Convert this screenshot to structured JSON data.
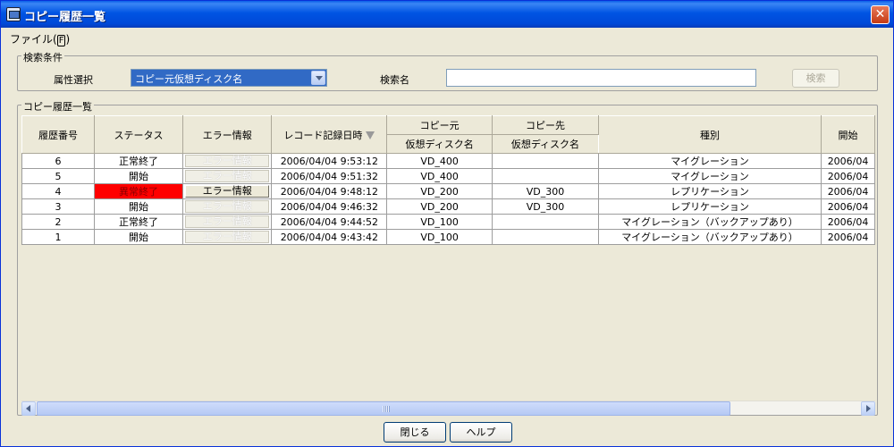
{
  "window": {
    "title": "コピー履歴一覧",
    "close_glyph": "✕"
  },
  "menu": {
    "file_label": "ファイル",
    "file_mnemonic": "F"
  },
  "search": {
    "group_label": "検索条件",
    "attr_label": "属性選択",
    "attr_value": "コピー元仮想ディスク名",
    "name_label": "検索名",
    "name_value": "",
    "button_label": "検索"
  },
  "list": {
    "group_label": "コピー履歴一覧",
    "columns": {
      "history_no": "履歴番号",
      "status": "ステータス",
      "error_info": "エラー情報",
      "record_time": "レコード記録日時",
      "copy_source": "コピー元",
      "copy_dest": "コピー先",
      "source_vdisk": "仮想ディスク名",
      "dest_vdisk": "仮想ディスク名",
      "type": "種別",
      "start": "開始"
    },
    "rows": [
      {
        "no": "6",
        "status": "正常終了",
        "error_btn": "エラー情報",
        "error_enabled": false,
        "time": "2006/04/04 9:53:12",
        "source": "VD_400",
        "dest": "",
        "type": "マイグレーション",
        "start": "2006/04"
      },
      {
        "no": "5",
        "status": "開始",
        "error_btn": "エラー情報",
        "error_enabled": false,
        "time": "2006/04/04 9:51:32",
        "source": "VD_400",
        "dest": "",
        "type": "マイグレーション",
        "start": "2006/04"
      },
      {
        "no": "4",
        "status": "異常終了",
        "error_btn": "エラー情報",
        "error_enabled": true,
        "time": "2006/04/04 9:48:12",
        "source": "VD_200",
        "dest": "VD_300",
        "type": "レプリケーション",
        "start": "2006/04"
      },
      {
        "no": "3",
        "status": "開始",
        "error_btn": "エラー情報",
        "error_enabled": false,
        "time": "2006/04/04 9:46:32",
        "source": "VD_200",
        "dest": "VD_300",
        "type": "レプリケーション",
        "start": "2006/04"
      },
      {
        "no": "2",
        "status": "正常終了",
        "error_btn": "エラー情報",
        "error_enabled": false,
        "time": "2006/04/04 9:44:52",
        "source": "VD_100",
        "dest": "",
        "type": "マイグレーション（バックアップあり）",
        "start": "2006/04"
      },
      {
        "no": "1",
        "status": "開始",
        "error_btn": "エラー情報",
        "error_enabled": false,
        "time": "2006/04/04 9:43:42",
        "source": "VD_100",
        "dest": "",
        "type": "マイグレーション（バックアップあり）",
        "start": "2006/04"
      }
    ],
    "error_status_color": "#ff0000"
  },
  "buttons": {
    "close": "閉じる",
    "help": "ヘルプ"
  }
}
